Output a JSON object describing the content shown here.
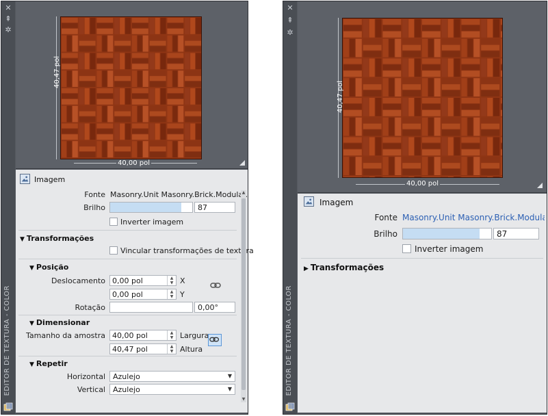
{
  "panels": [
    {
      "palette_title": "EDITOR DE TEXTURA - COLOR",
      "dimensions": {
        "width_label": "40,00 pol",
        "height_label": "40,47 pol"
      },
      "image_section": {
        "title": "Imagem",
        "source_label": "Fonte",
        "source_value": "Masonry.Unit Masonry.Brick.Modular.B",
        "brightness_label": "Brilho",
        "brightness_value": "87",
        "brightness_level": 87,
        "invert_label": "Inverter imagem",
        "invert_checked": false
      },
      "transforms": {
        "title": "Transformações",
        "expanded": true,
        "link_label": "Vincular transformações de textura",
        "link_checked": false,
        "position": {
          "title": "Posição",
          "offset_label": "Deslocamento",
          "offset_x": "0,00 pol",
          "offset_y": "0,00 pol",
          "x_axis": "X",
          "y_axis": "Y",
          "rotation_label": "Rotação",
          "rotation_value": "0,00°"
        },
        "scale": {
          "title": "Dimensionar",
          "sample_size_label": "Tamanho da amostra",
          "width_value": "40,00 pol",
          "height_value": "40,47 pol",
          "width_label": "Largura",
          "height_label": "Altura"
        },
        "repeat": {
          "title": "Repetir",
          "horizontal_label": "Horizontal",
          "horizontal_value": "Azulejo",
          "vertical_label": "Vertical",
          "vertical_value": "Azulejo"
        }
      }
    },
    {
      "palette_title": "EDITOR DE TEXTURA - COLOR",
      "dimensions": {
        "width_label": "40,00 pol",
        "height_label": "40,47 pol"
      },
      "image_section": {
        "title": "Imagem",
        "source_label": "Fonte",
        "source_value": "Masonry.Unit Masonry.Brick.Modular.",
        "brightness_label": "Brilho",
        "brightness_value": "87",
        "brightness_level": 87,
        "invert_label": "Inverter imagem",
        "invert_checked": false
      },
      "transforms": {
        "title": "Transformações",
        "expanded": false
      }
    }
  ],
  "colors": {
    "palette_bg": "#54585f",
    "preview_bg": "#5d6168",
    "props_bg": "#e7e8ea",
    "brick": "#7c2d10",
    "link_text": "#2b5fb3",
    "slider_fill": "#c5ddf3"
  },
  "icons": {
    "close": "close-icon",
    "autohide": "pin-icon",
    "properties": "settings-icon",
    "image": "image-icon",
    "link": "chain-link-icon",
    "texture_editor": "texture-editor-icon"
  }
}
